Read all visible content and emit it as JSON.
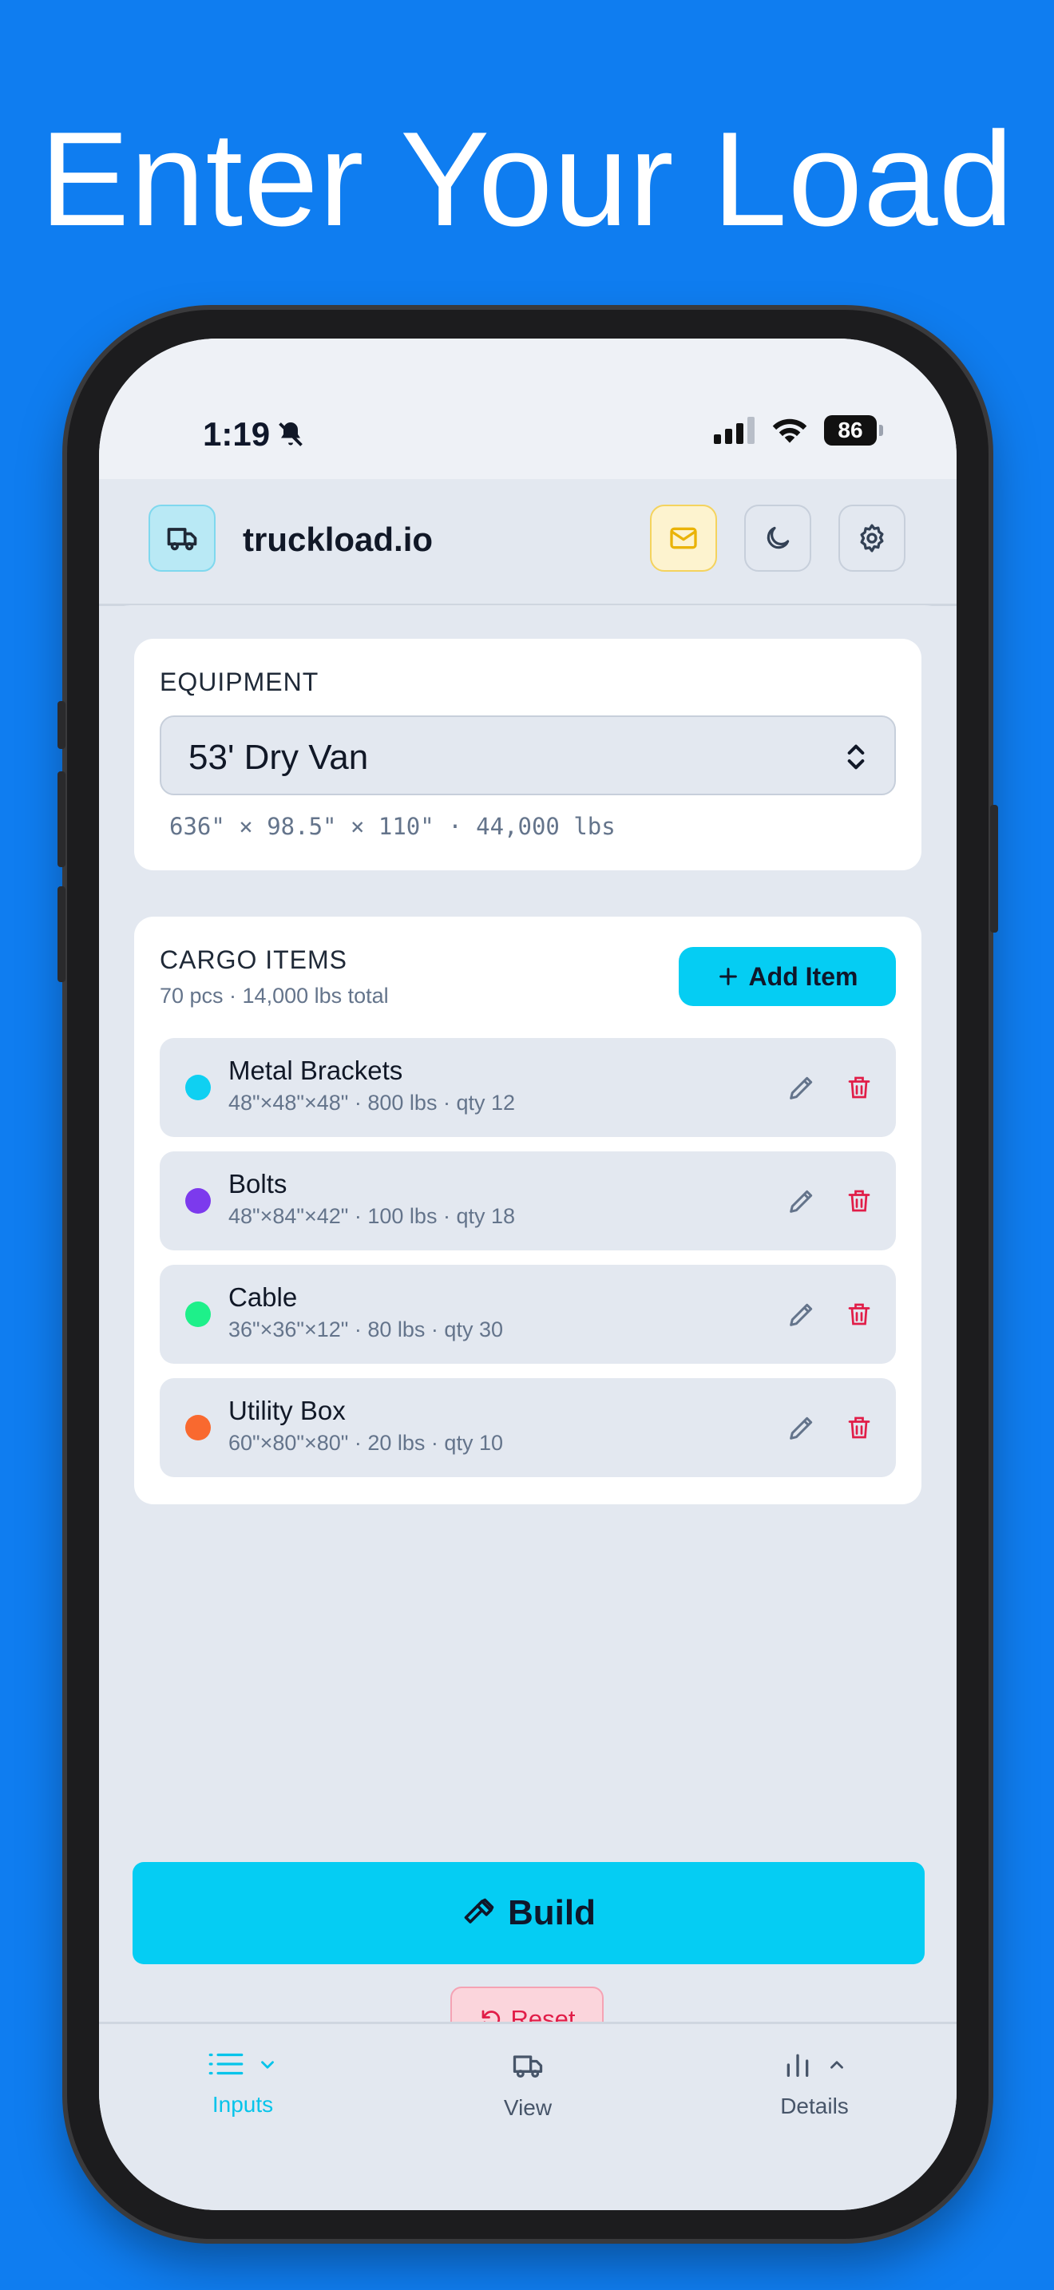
{
  "headline": "Enter Your Load",
  "status": {
    "time": "1:19",
    "battery": "86"
  },
  "header": {
    "brand": "truckload.io"
  },
  "equipment": {
    "title": "EQUIPMENT",
    "selected": "53' Dry Van",
    "spec": "636\" × 98.5\" × 110\" · 44,000 lbs"
  },
  "cargo": {
    "title": "CARGO ITEMS",
    "summary": "70 pcs · 14,000 lbs total",
    "add_label": "Add Item",
    "items": [
      {
        "name": "Metal Brackets",
        "meta": "48\"×48\"×48\" · 800 lbs · qty 12",
        "color": "#0fd0f2"
      },
      {
        "name": "Bolts",
        "meta": "48\"×84\"×42\" · 100 lbs · qty 18",
        "color": "#7c3aed"
      },
      {
        "name": "Cable",
        "meta": "36\"×36\"×12\" · 80 lbs · qty 30",
        "color": "#1ef08a"
      },
      {
        "name": "Utility Box",
        "meta": "60\"×80\"×80\" · 20 lbs · qty 10",
        "color": "#f9692f"
      }
    ]
  },
  "actions": {
    "build_label": "Build",
    "reset_label": "Reset"
  },
  "tabs": [
    {
      "label": "Inputs",
      "icon": "list-icon",
      "active": true
    },
    {
      "label": "View",
      "icon": "truck-icon",
      "active": false
    },
    {
      "label": "Details",
      "icon": "bar-chart-icon",
      "active": false
    }
  ],
  "colors": {
    "accent": "#05cdf3",
    "background": "#0f7df0",
    "danger": "#e11d48"
  }
}
